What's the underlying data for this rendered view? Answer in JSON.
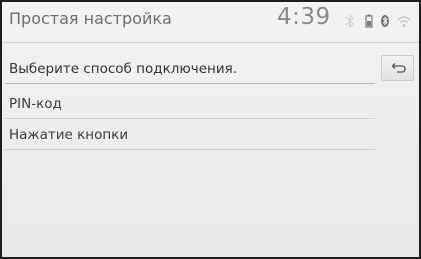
{
  "header": {
    "title": "Простая настройка",
    "time": "4:39",
    "status_icons": [
      "bluetooth-muted-icon",
      "phone-battery-icon",
      "bluetooth-icon",
      "wifi-icon"
    ]
  },
  "main": {
    "prompt": "Выберите способ подключения.",
    "options": [
      {
        "label": "PIN-код"
      },
      {
        "label": "Нажатие кнопки"
      }
    ],
    "back_icon": "return-arrow-icon"
  },
  "colors": {
    "background": "#ececec",
    "frame": "#1e1e1e",
    "text": "#3a3a3a",
    "divider": "#cfcfcf"
  }
}
